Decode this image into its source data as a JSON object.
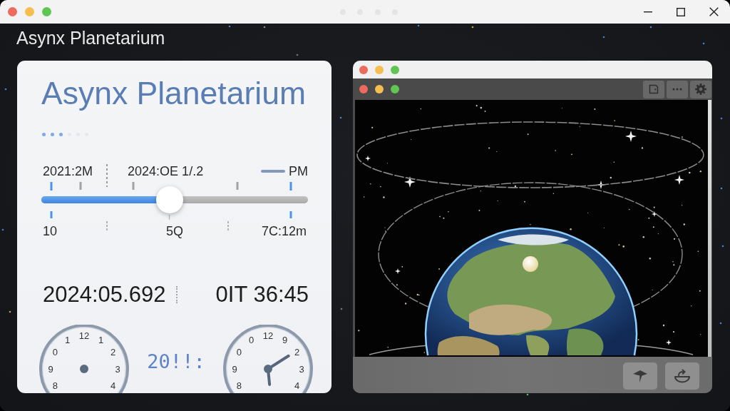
{
  "app_title": "Asynx Planetarium",
  "time_card": {
    "heading": "Asynx Planetarium",
    "step_dots": [
      {
        "active": true
      },
      {
        "active": true
      },
      {
        "active": true
      },
      {
        "active": false
      },
      {
        "active": false
      },
      {
        "active": false
      }
    ],
    "timeline": {
      "labels_above": [
        "2021:2M",
        "2024:OE 1/.2"
      ],
      "legend": "PM",
      "level": 0.48,
      "labels_below": [
        "10",
        "5Q",
        "7C:12m"
      ]
    },
    "readouts": [
      "2024:05.692",
      "0IT 36:45"
    ],
    "clocks": [
      {
        "right_numerals": [
          "12",
          "1",
          "2",
          "3",
          "4"
        ],
        "left_numerals": [
          "8",
          "9",
          "0",
          "1"
        ],
        "hands": false
      },
      {
        "right_numerals": [
          "12",
          "9",
          "2",
          "3",
          "4"
        ],
        "left_numerals": [
          "8",
          "9",
          "0",
          "0"
        ],
        "hands": true
      }
    ],
    "digital": "20!!:"
  },
  "viewer": {
    "toolbar_buttons": [
      {
        "kind": "save"
      },
      {
        "kind": "more"
      },
      {
        "kind": "settings"
      }
    ],
    "action_buttons": [
      {
        "kind": "pin"
      },
      {
        "kind": "bowl"
      }
    ]
  }
}
